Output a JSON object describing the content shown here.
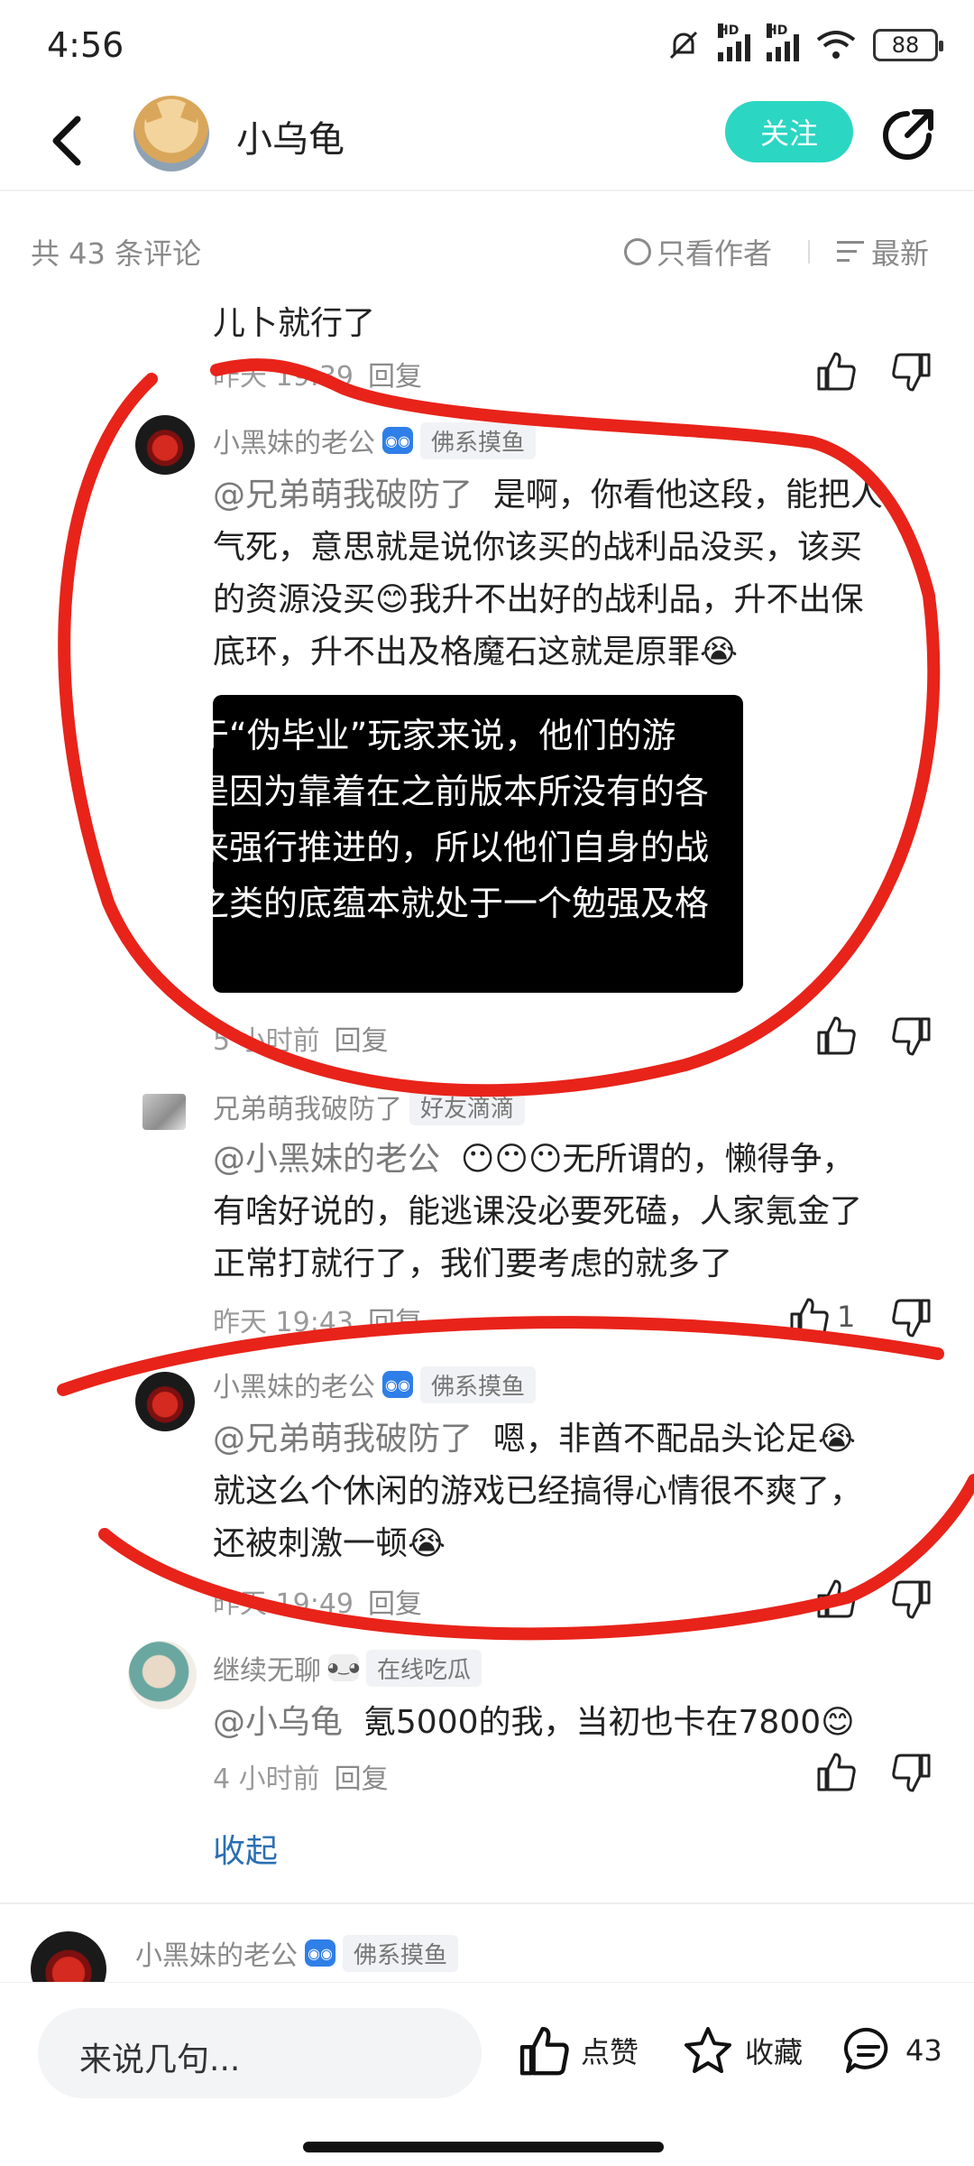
{
  "status_bar": {
    "time": "4:56",
    "battery": "88",
    "hd1": "HD",
    "hd2": "HD"
  },
  "nav": {
    "title": "小乌龟",
    "follow_label": "关注"
  },
  "comments_header": {
    "count": "共 43 条评论",
    "only_author": "只看作者",
    "sort": "最新"
  },
  "comments": [
    {
      "text": "儿卜就行了",
      "time": "昨天 19:39",
      "reply": "回复"
    },
    {
      "user": "小黑妹的老公",
      "tag": "佛系摸鱼",
      "mention": "@兄弟萌我破防了",
      "lines": [
        "是啊，你看他这段，能把人",
        "气死，意思就是说你该买的战利品没买，该买",
        "的资源没买😊我升不出好的战利品，升不出保",
        "底环，升不出及格魔石这就是原罪😭"
      ],
      "image_lines": [
        "于“伪毕业”玩家来说，他们的游",
        "是因为靠着在之前版本所没有的各",
        "来强行推进的，所以他们自身的战",
        "之类的底蕴本就处于一个勉强及格"
      ],
      "time": "5 小时前",
      "reply": "回复"
    },
    {
      "user": "兄弟萌我破防了",
      "tag": "好友滴滴",
      "mention": "@小黑妹的老公",
      "lines": [
        "😶😶😶无所谓的，懒得争，",
        "有啥好说的，能逃课没必要死磕，人家氪金了",
        "正常打就行了，我们要考虑的就多了"
      ],
      "time": "昨天 19:43",
      "reply": "回复",
      "likes": "1"
    },
    {
      "user": "小黑妹的老公",
      "tag": "佛系摸鱼",
      "mention": "@兄弟萌我破防了",
      "lines": [
        "嗯，非酋不配品头论足😭",
        "就这么个休闲的游戏已经搞得心情很不爽了，",
        "还被刺激一顿😭"
      ],
      "time": "昨天 19:49",
      "reply": "回复"
    },
    {
      "user": "继续无聊",
      "tag": "在线吃瓜",
      "mention": "@小乌龟",
      "lines": [
        "氪5000的我，当初也卡在7800😊"
      ],
      "time": "4 小时前",
      "reply": "回复"
    }
  ],
  "collapse_label": "收起",
  "next_comment": {
    "user": "小黑妹的老公",
    "tag": "佛系摸鱼"
  },
  "bottom_bar": {
    "input_placeholder": "来说几句...",
    "like_label": "点赞",
    "collect_label": "收藏",
    "comment_count": "43"
  },
  "colors": {
    "accent": "#2bd6c3",
    "link": "#2a6fb3",
    "annotation": "#e8231a"
  },
  "icons": [
    "back-arrow-icon",
    "share-icon",
    "thumb-up-icon",
    "thumb-down-icon",
    "star-icon",
    "comment-icon",
    "sort-icon"
  ]
}
